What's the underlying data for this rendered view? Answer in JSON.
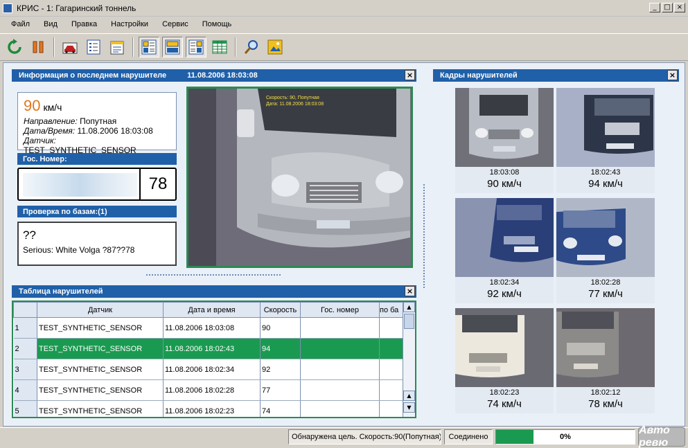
{
  "window": {
    "title": "КРИС - 1: Гагаринский тоннель",
    "min": "_",
    "max": "□",
    "close": "×"
  },
  "menu": [
    "Файл",
    "Вид",
    "Правка",
    "Настройки",
    "Сервис",
    "Помощь"
  ],
  "toolbar_icons": [
    "refresh-icon",
    "pause-icon",
    "car-icon",
    "list-check-icon",
    "edit-note-icon",
    "layout-left-icon",
    "layout-center-icon",
    "layout-right-icon",
    "table-icon",
    "search-icon",
    "image-icon"
  ],
  "last_violator": {
    "header": "Информация о последнем нарушителе",
    "datetime": "11.08.2006 18:03:08",
    "speed": "90",
    "speed_unit": "км/ч",
    "direction_label": "Направление:",
    "direction": "Попутная",
    "datetime_label": "Дата/Время:",
    "datetime_value": "11.08.2006 18:03:08",
    "sensor_label": "Датчик:",
    "sensor": "TEST_SYNTHETIC_SENSOR",
    "plate_header": "Гос. Номер:",
    "plate_region": "78",
    "db_header": "Проверка по базам:(1)",
    "db_code": "??",
    "db_note": "Serious: White Volga ?87??78",
    "photo_caption_1": "Скорость: 90, Попутная",
    "photo_caption_2": "Дата: 11.08.2006 18:03:08"
  },
  "violators_table": {
    "header": "Таблица нарушителей",
    "columns": [
      "Датчик",
      "Дата и время",
      "Скорость",
      "Гос. номер",
      "по ба"
    ],
    "rows": [
      {
        "n": "1",
        "sensor": "TEST_SYNTHETIC_SENSOR",
        "datetime": "11.08.2006 18:03:08",
        "speed": "90",
        "plate": ""
      },
      {
        "n": "2",
        "sensor": "TEST_SYNTHETIC_SENSOR",
        "datetime": "11.08.2006 18:02:43",
        "speed": "94",
        "plate": ""
      },
      {
        "n": "3",
        "sensor": "TEST_SYNTHETIC_SENSOR",
        "datetime": "11.08.2006 18:02:34",
        "speed": "92",
        "plate": ""
      },
      {
        "n": "4",
        "sensor": "TEST_SYNTHETIC_SENSOR",
        "datetime": "11.08.2006 18:02:28",
        "speed": "77",
        "plate": ""
      },
      {
        "n": "5",
        "sensor": "TEST_SYNTHETIC_SENSOR",
        "datetime": "11.08.2006 18:02:23",
        "speed": "74",
        "plate": ""
      }
    ]
  },
  "frames": {
    "header": "Кадры нарушителей",
    "items": [
      {
        "time": "18:03:08",
        "speed": "90 км/ч",
        "car_color": "#b8bcc4"
      },
      {
        "time": "18:02:43",
        "speed": "94 км/ч",
        "car_color": "#2c3648"
      },
      {
        "time": "18:02:34",
        "speed": "92 км/ч",
        "car_color": "#2a3e78"
      },
      {
        "time": "18:02:28",
        "speed": "77 км/ч",
        "car_color": "#2e4a88"
      },
      {
        "time": "18:02:23",
        "speed": "74 км/ч",
        "car_color": "#ece8de"
      },
      {
        "time": "18:02:12",
        "speed": "78 км/ч",
        "car_color": "#8c8a88"
      }
    ]
  },
  "status": {
    "message": "Обнаружена цель. Скорость:90(Попутная)",
    "connection": "Соединено",
    "progress_text": "0%",
    "progress_fraction": 0.27,
    "badge": "Авто ревю"
  },
  "colors": {
    "header_blue": "#2060a8",
    "selected_row": "#1a9a50",
    "speed_orange": "#e07820",
    "frame_green": "#2a8a54"
  }
}
